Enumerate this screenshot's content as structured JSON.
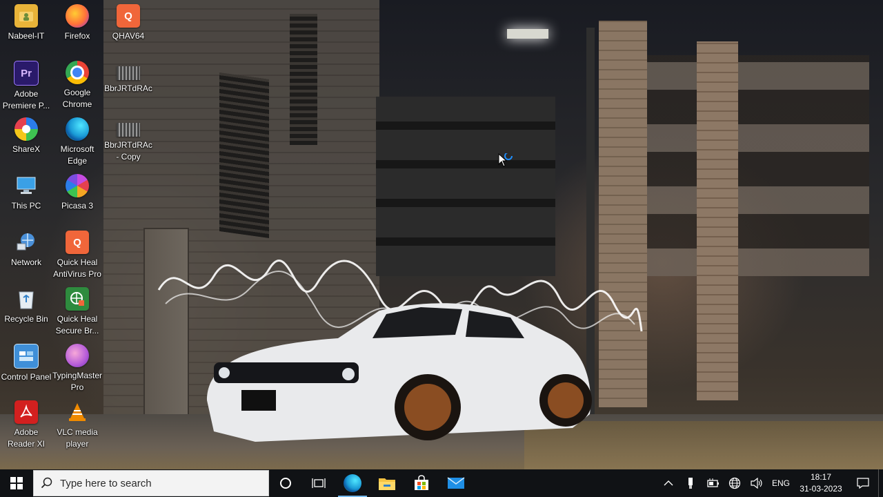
{
  "desktop": {
    "icons": [
      {
        "label": "Nabeel-IT",
        "icon": "user-folder-icon",
        "color": "#e8b339"
      },
      {
        "label": "Firefox",
        "icon": "firefox-icon",
        "color": "#ff7139"
      },
      {
        "label": "QHAV64",
        "icon": "quickheal-setup-icon",
        "color": "#f0663a"
      },
      {
        "label": "Adobe Premiere P...",
        "icon": "premiere-icon",
        "color": "#2a1a6a"
      },
      {
        "label": "Google Chrome",
        "icon": "chrome-icon",
        "color": "#34a853"
      },
      {
        "label": "BbrJRTdRAc",
        "icon": "video-file-icon",
        "color": "#3a3a3a"
      },
      {
        "label": "ShareX",
        "icon": "sharex-icon",
        "color": "#2b7de9"
      },
      {
        "label": "Microsoft Edge",
        "icon": "edge-icon",
        "color": "#1a9ad6"
      },
      {
        "label": "BbrJRTdRAc - Copy",
        "icon": "video-file-icon",
        "color": "#3a3a3a"
      },
      {
        "label": "This PC",
        "icon": "this-pc-icon",
        "color": "#3aa0e6"
      },
      {
        "label": "Picasa 3",
        "icon": "picasa-icon",
        "color": "#c64be0"
      },
      {
        "label": "Network",
        "icon": "network-icon",
        "color": "#4a90d9"
      },
      {
        "label": "Quick Heal AntiVirus Pro",
        "icon": "quickheal-icon",
        "color": "#f0663a"
      },
      {
        "label": "Recycle Bin",
        "icon": "recycle-bin-icon",
        "color": "#dfe7ee"
      },
      {
        "label": "Quick Heal Secure Br...",
        "icon": "quickheal-browser-icon",
        "color": "#2e8b3e"
      },
      {
        "label": "Control Panel",
        "icon": "control-panel-icon",
        "color": "#3f8fd8"
      },
      {
        "label": "TypingMaster Pro",
        "icon": "typingmaster-icon",
        "color": "#b45ad8"
      },
      {
        "label": "Adobe Reader XI",
        "icon": "adobe-reader-icon",
        "color": "#d3201f"
      },
      {
        "label": "VLC media player",
        "icon": "vlc-icon",
        "color": "#f08a00"
      }
    ],
    "glyphs": {
      "premiere": "Pr",
      "quickheal": "Q"
    }
  },
  "taskbar": {
    "search_placeholder": "Type here to search",
    "apps": [
      {
        "name": "edge",
        "icon": "edge-icon",
        "active": true
      },
      {
        "name": "file-explorer",
        "icon": "folder-icon",
        "active": false
      },
      {
        "name": "store",
        "icon": "store-icon",
        "active": false
      },
      {
        "name": "mail",
        "icon": "mail-icon",
        "active": false
      }
    ],
    "tray": {
      "language": "ENG",
      "time": "18:17",
      "date": "31-03-2023"
    }
  },
  "colors": {
    "taskbar_bg": "#101215",
    "accent": "#76b9ed"
  }
}
